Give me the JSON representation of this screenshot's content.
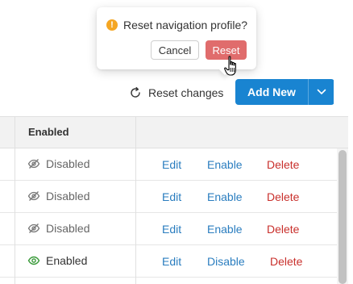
{
  "popconfirm": {
    "message": "Reset navigation profile?",
    "warning_icon": "!",
    "cancel_label": "Cancel",
    "reset_label": "Reset"
  },
  "toolbar": {
    "reset_changes_label": "Reset changes",
    "add_new_label": "Add New"
  },
  "table": {
    "header_enabled": "Enabled",
    "rows": [
      {
        "status": "Disabled",
        "edit": "Edit",
        "toggle": "Enable",
        "delete": "Delete"
      },
      {
        "status": "Disabled",
        "edit": "Edit",
        "toggle": "Enable",
        "delete": "Delete"
      },
      {
        "status": "Disabled",
        "edit": "Edit",
        "toggle": "Enable",
        "delete": "Delete"
      },
      {
        "status": "Enabled",
        "edit": "Edit",
        "toggle": "Disable",
        "delete": "Delete"
      }
    ]
  },
  "colors": {
    "primary": "#1984d1",
    "danger_button": "#e06c6c",
    "link_blue": "#2a7dbf",
    "link_red": "#c9302c",
    "enabled_green": "#3a9a3a",
    "warning": "#f5a623"
  },
  "icons": {
    "warning": "warning-icon",
    "refresh": "refresh-icon",
    "caret": "chevron-down-icon",
    "disabled": "eye-off-icon",
    "enabled": "eye-icon",
    "cursor": "hand-pointer-icon"
  }
}
